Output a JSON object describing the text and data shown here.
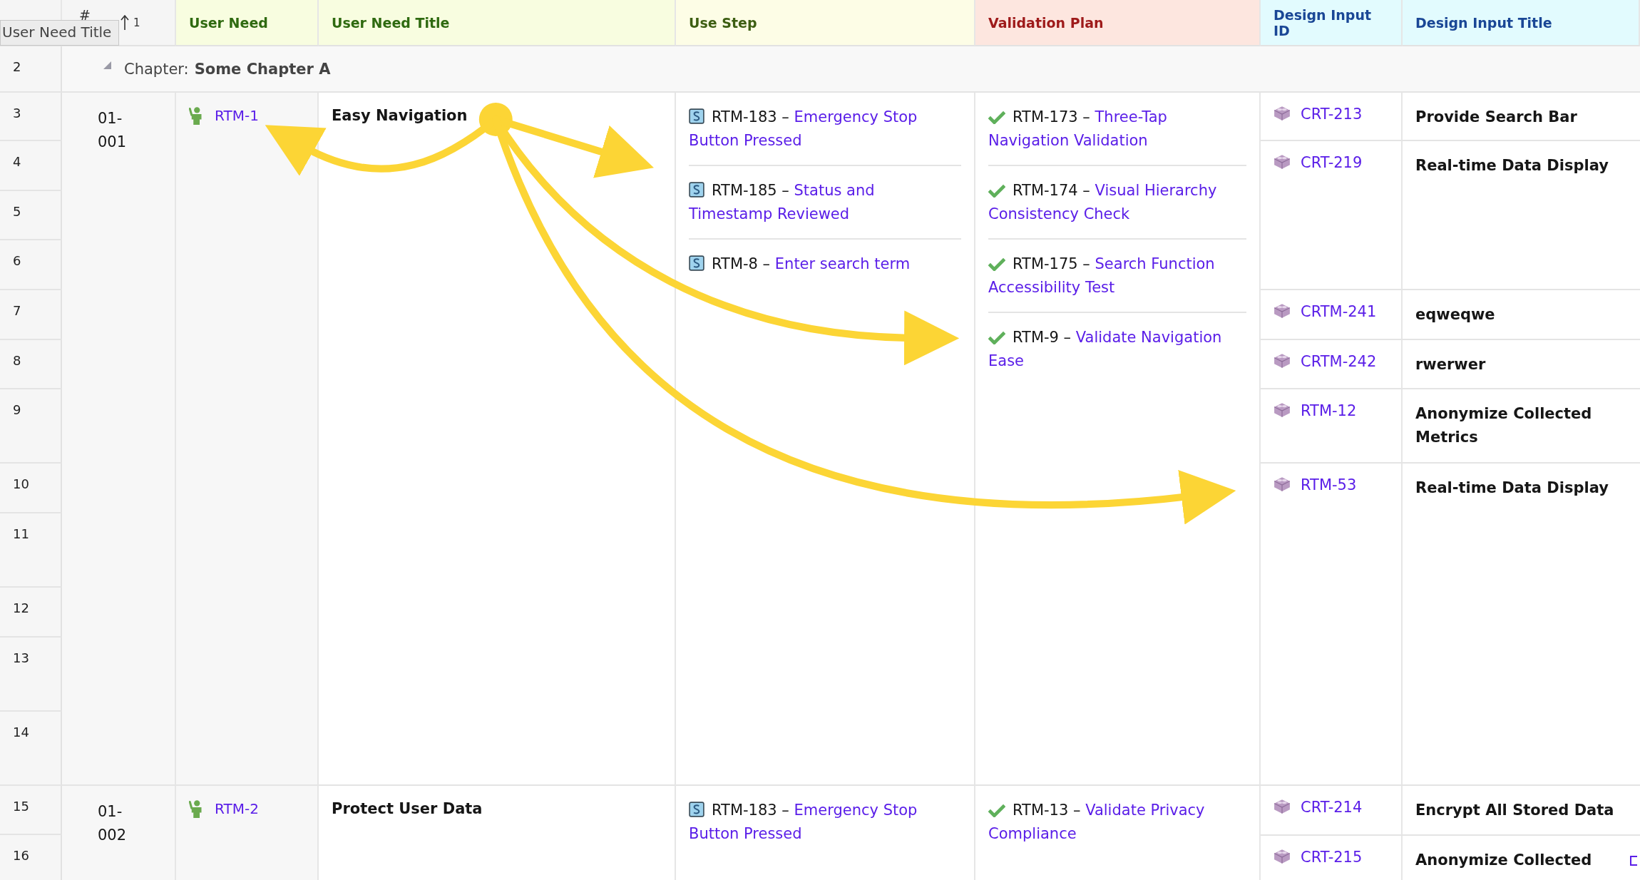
{
  "tooltip": "User Need Title",
  "header": {
    "row_number": "#",
    "sort_order": "1",
    "columns": [
      {
        "label": "User Need"
      },
      {
        "label": "User Need Title"
      },
      {
        "label": "Use Step"
      },
      {
        "label": "Validation Plan"
      },
      {
        "label": "Design Input ID"
      },
      {
        "label": "Design Input Title"
      }
    ]
  },
  "chapter": {
    "number": "2",
    "label": "Chapter:",
    "title": "Some Chapter A",
    "expanded": true
  },
  "requirements": [
    {
      "row_numbers": [
        "3",
        "4",
        "5",
        "6",
        "7",
        "8",
        "9",
        "10",
        "11",
        "12",
        "13",
        "14"
      ],
      "id": "01-001",
      "user_need": "RTM-1",
      "title": "Easy Navigation",
      "use_steps": [
        {
          "id": "RTM-183 –",
          "title": "Emergency Stop Button Pressed"
        },
        {
          "id": "RTM-185 –",
          "title": "Status and Timestamp Reviewed"
        },
        {
          "id": "RTM-8 –",
          "title": "Enter search term"
        }
      ],
      "validations": [
        {
          "id": "RTM-173 –",
          "title": "Three-Tap Navigation Validation"
        },
        {
          "id": "RTM-174 –",
          "title": "Visual Hierarchy Consistency Check"
        },
        {
          "id": "RTM-175 –",
          "title": "Search Function Accessibility Test"
        },
        {
          "id": "RTM-9 –",
          "title": "Validate Navigation Ease"
        }
      ],
      "design_inputs": [
        {
          "id": "CRT-213",
          "title": "Provide Search Bar"
        },
        {
          "id": "CRT-219",
          "title": "Real-time Data Display"
        },
        {
          "id": "CRTM-241",
          "title": "eqweqwe"
        },
        {
          "id": "CRTM-242",
          "title": "rwerwer"
        },
        {
          "id": "RTM-12",
          "title": "Anonymize Collected Metrics"
        },
        {
          "id": "RTM-53",
          "title": "Real-time Data Display"
        }
      ]
    },
    {
      "row_numbers": [
        "15",
        "16"
      ],
      "id": "01-002",
      "user_need": "RTM-2",
      "title": "Protect User Data",
      "use_steps": [
        {
          "id": "RTM-183 –",
          "title": "Emergency Stop Button Pressed"
        }
      ],
      "validations": [
        {
          "id": "RTM-13 –",
          "title": "Validate Privacy Compliance"
        }
      ],
      "design_inputs": [
        {
          "id": "CRT-214",
          "title": "Encrypt All Stored Data"
        },
        {
          "id": "CRT-215",
          "title": "Anonymize Collected"
        }
      ]
    }
  ]
}
